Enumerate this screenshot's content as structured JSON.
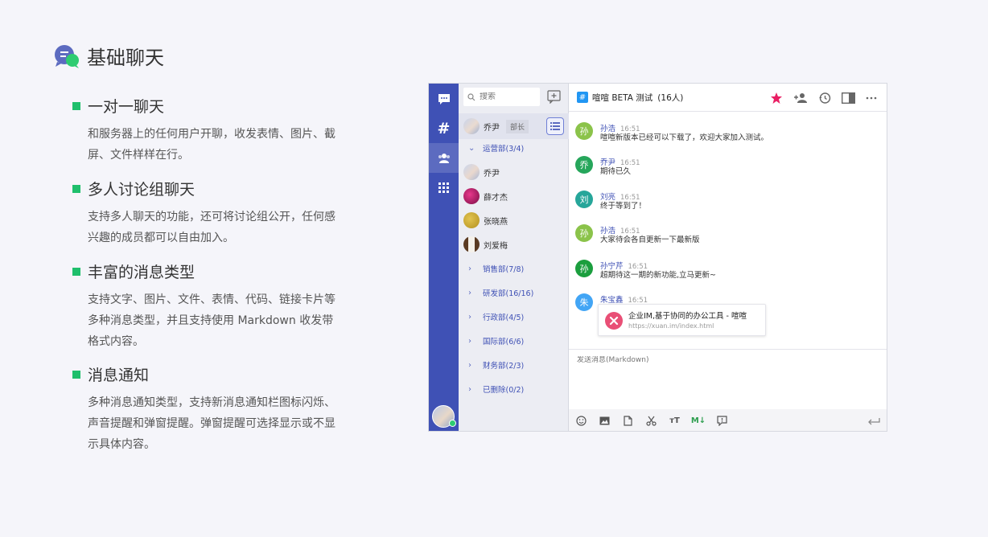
{
  "section": {
    "title": "基础聊天",
    "icon": "chat-bubbles-icon"
  },
  "features": [
    {
      "title": "一对一聊天",
      "desc": "和服务器上的任何用户开聊，收发表情、图片、截屏、文件样样在行。"
    },
    {
      "title": "多人讨论组聊天",
      "desc": "支持多人聊天的功能，还可将讨论组公开，任何感兴趣的成员都可以自由加入。"
    },
    {
      "title": "丰富的消息类型",
      "desc": "支持文字、图片、文件、表情、代码、链接卡片等多种消息类型，并且支持使用 Markdown 收发带格式内容。"
    },
    {
      "title": "消息通知",
      "desc": "多种消息通知类型，支持新消息通知栏图标闪烁、声音提醒和弹窗提醒。弹窗提醒可选择显示或不显示具体内容。"
    }
  ],
  "colors": {
    "accent": "#3f51b5",
    "bullet": "#1fbf6c",
    "star": "#e91e63"
  },
  "app": {
    "nav_icons": [
      "chat-icon",
      "channel-hash-icon",
      "contacts-icon",
      "apps-grid-icon"
    ],
    "search": {
      "placeholder": "搜索"
    },
    "me": {
      "name": "乔尹",
      "role": "部长"
    },
    "groups": [
      {
        "label": "运营部(3/4)",
        "expanded": true
      },
      {
        "label": "销售部(7/8)",
        "expanded": false
      },
      {
        "label": "研发部(16/16)",
        "expanded": false
      },
      {
        "label": "行政部(4/5)",
        "expanded": false
      },
      {
        "label": "国际部(6/6)",
        "expanded": false
      },
      {
        "label": "财务部(2/3)",
        "expanded": false
      },
      {
        "label": "已删除(0/2)",
        "expanded": false
      }
    ],
    "members": [
      {
        "name": "乔尹",
        "color": "#c9d6ee"
      },
      {
        "name": "薛才杰",
        "color": "#b5176b"
      },
      {
        "name": "张晓燕",
        "color": "#d4b13a"
      },
      {
        "name": "刘爱梅",
        "color": "#6b4a2c"
      }
    ],
    "chat": {
      "title": "喧喧 BETA 测试",
      "count": "(16人)",
      "messages": [
        {
          "sender": "孙浩",
          "time": "16:51",
          "text": "喧喧新版本已经可以下载了，欢迎大家加入测试。",
          "avatar": "孙",
          "color": "#8bc34a"
        },
        {
          "sender": "乔尹",
          "time": "16:51",
          "text": "期待已久",
          "avatar": "乔",
          "color": "#26a65b"
        },
        {
          "sender": "刘亮",
          "time": "16:51",
          "text": "终于等到了！",
          "avatar": "刘",
          "color": "#26a69a"
        },
        {
          "sender": "孙浩",
          "time": "16:51",
          "text": "大家待会各自更新一下最新版",
          "avatar": "孙",
          "color": "#8bc34a"
        },
        {
          "sender": "孙宁芹",
          "time": "16:51",
          "text": "超期待这一期的新功能,立马更新~",
          "avatar": "孙",
          "color": "#1b9e3e"
        },
        {
          "sender": "朱宝鑫",
          "time": "16:51",
          "text": "",
          "avatar": "朱",
          "color": "#42a5f5"
        }
      ],
      "link_card": {
        "title": "企业IM,基于协同的办公工具 - 喧喧",
        "url": "https://xuan.im/index.html"
      },
      "composer_placeholder": "发送消息(Markdown)",
      "toolbar": [
        "emoji-icon",
        "image-icon",
        "file-icon",
        "screenshot-icon",
        "font-size-icon",
        "markdown-icon",
        "code-snippet-icon"
      ]
    }
  }
}
